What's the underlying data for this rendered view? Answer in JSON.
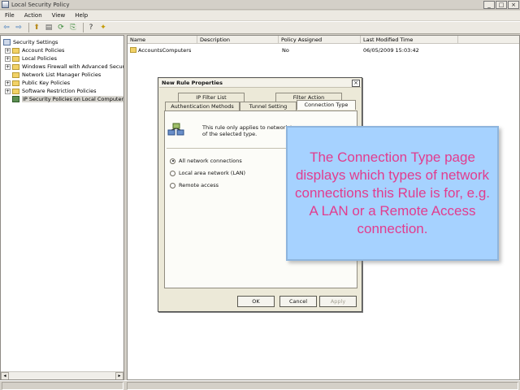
{
  "window": {
    "title": "Local Security Policy",
    "minimize_label": "_",
    "maximize_label": "□",
    "close_label": "×"
  },
  "menu": [
    "File",
    "Action",
    "View",
    "Help"
  ],
  "toolbar": {
    "back_glyph": "⇦",
    "forward_glyph": "⇨",
    "up_glyph": "⬆",
    "refresh_glyph": "⟳",
    "export_glyph": "⎘",
    "help_glyph": "?",
    "properties_glyph": "▤",
    "add_glyph": "✦"
  },
  "tree": {
    "root": "Security Settings",
    "items": [
      "Account Policies",
      "Local Policies",
      "Windows Firewall with Advanced Security",
      "Network List Manager Policies",
      "Public Key Policies",
      "Software Restriction Policies",
      "IP Security Policies on Local Computer"
    ]
  },
  "list": {
    "columns": [
      "Name",
      "Description",
      "Policy Assigned",
      "Last Modified Time"
    ],
    "rows": [
      {
        "name": "AccountsComputers",
        "description": "",
        "assigned": "No",
        "modified": "06/05/2009 15:03:42"
      }
    ]
  },
  "dialog": {
    "title": "New Rule Properties",
    "close_label": "×",
    "tabs": [
      "IP Filter List",
      "Filter Action",
      "Authentication Methods",
      "Tunnel Setting",
      "Connection Type"
    ],
    "intro_text": "This rule only applies to network tr... of the selected type.",
    "options": [
      "All network connections",
      "Local area network (LAN)",
      "Remote access"
    ],
    "ok_label": "OK",
    "cancel_label": "Cancel",
    "apply_label": "Apply"
  },
  "callout": {
    "text": "The Connection Type page displays which types of network connections this Rule is for, e.g. A LAN or a Remote Access connection."
  },
  "colors": {
    "callout_bg": "#a6d2ff",
    "callout_text": "#e23c8e"
  }
}
